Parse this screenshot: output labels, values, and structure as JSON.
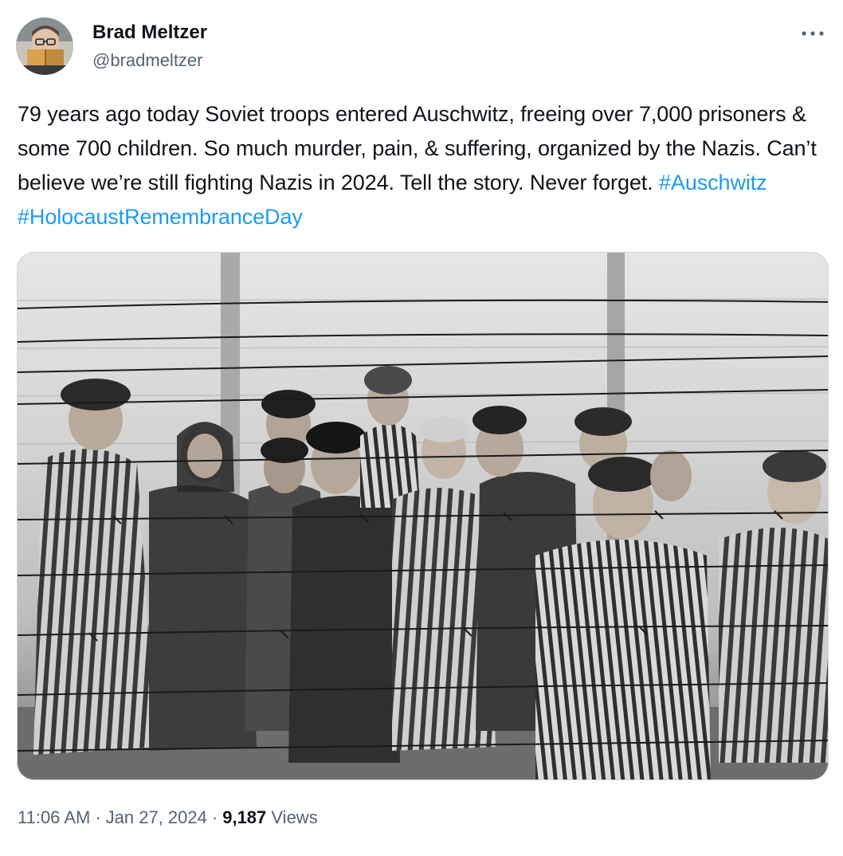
{
  "tweet": {
    "author": {
      "display_name": "Brad Meltzer",
      "handle": "@bradmeltzer",
      "avatar_icon": "user-avatar-photo"
    },
    "more_icon": "more-horizontal-icon",
    "text_parts": [
      "79 years ago today Soviet troops entered Auschwitz, freeing over 7,000 prisoners & some 700 children. So much murder, pain, & suffering, organized by the Nazis. Can’t believe we’re still fighting Nazis in 2024. Tell the story. Never forget. "
    ],
    "hashtags": [
      "#Auschwitz",
      "#HolocaustRemembranceDay"
    ],
    "media": {
      "kind": "photo",
      "palette": "black-and-white"
    },
    "meta": {
      "time": "11:06 AM",
      "separator": "·",
      "date": "Jan 27, 2024",
      "view_count": "9,187",
      "views_label": "Views"
    },
    "colors": {
      "link": "#1d9bf0",
      "text": "#0f1419",
      "secondary": "#536471"
    }
  }
}
